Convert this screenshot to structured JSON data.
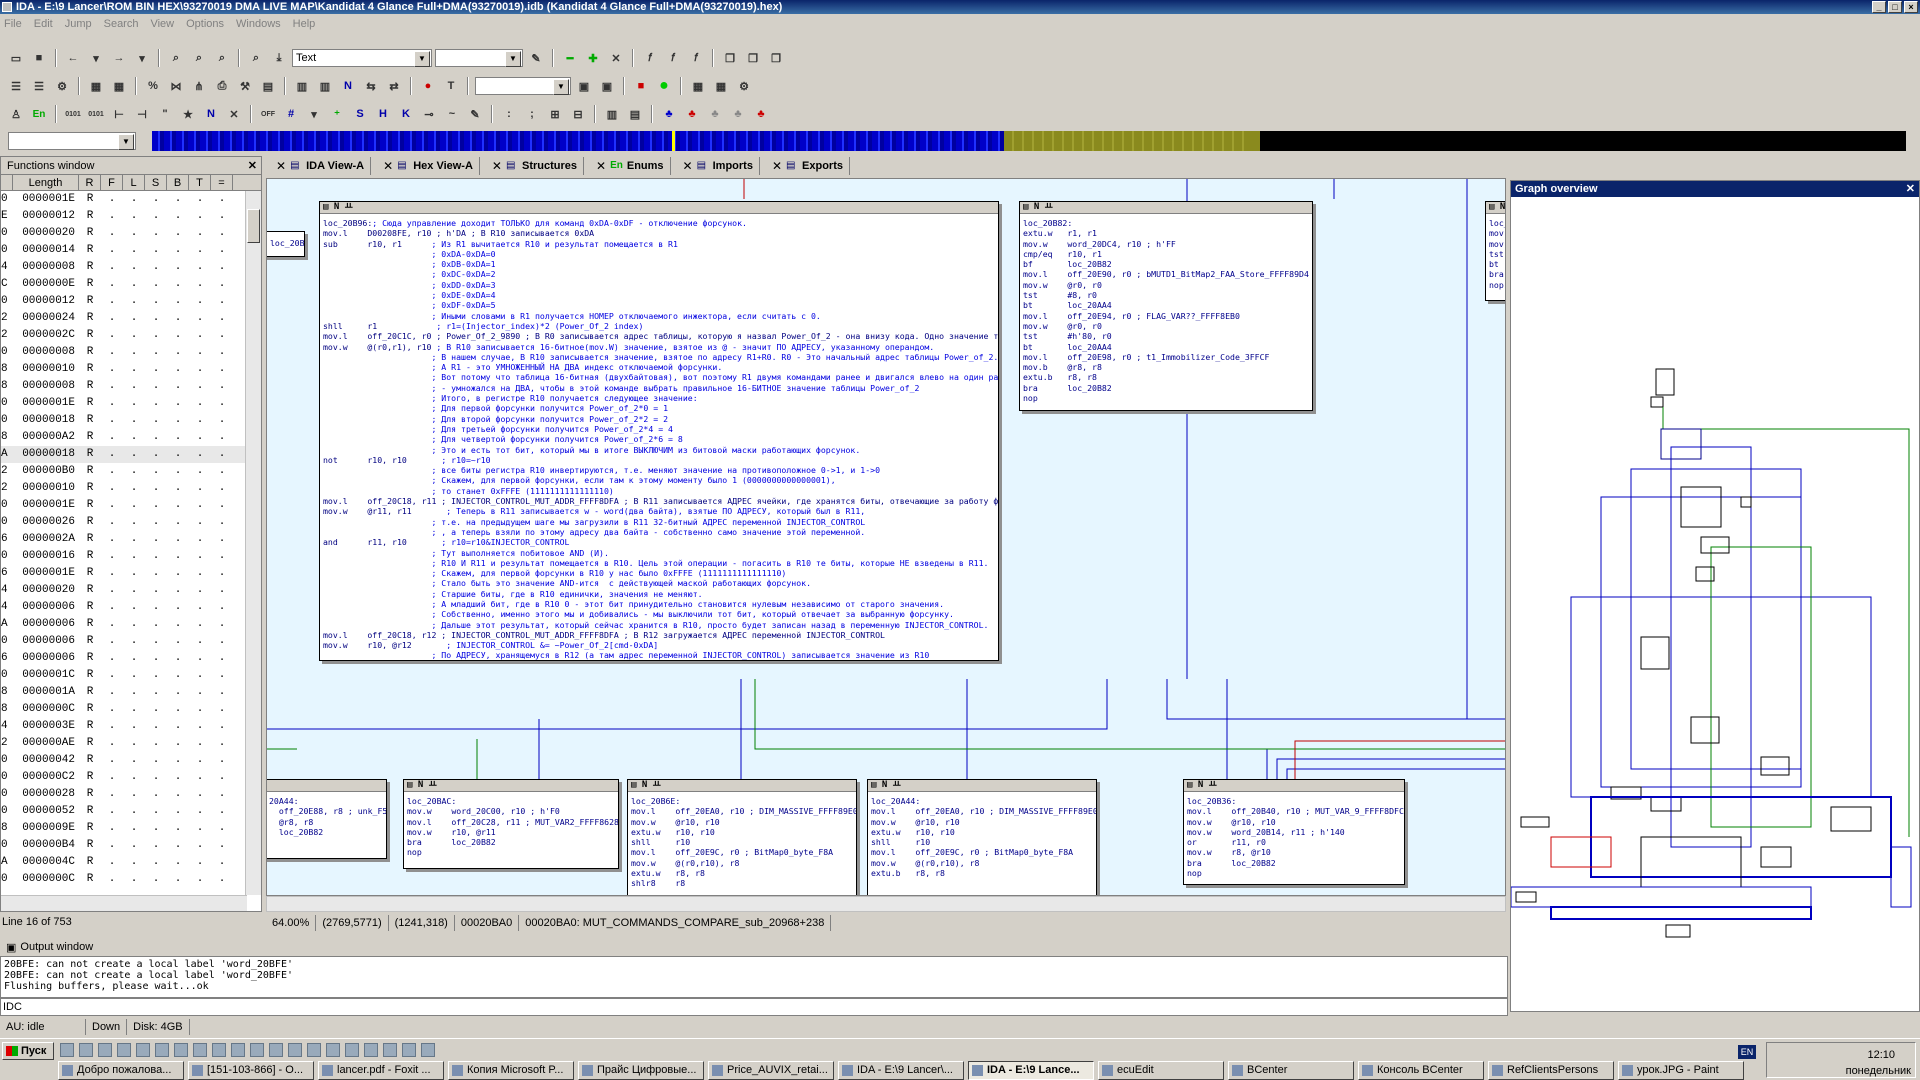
{
  "window": {
    "title": "IDA - E:\\9 Lancer\\ROM BIN HEX\\93270019 DMA LIVE MAP\\Kandidat 4 Glance Full+DMA(93270019).idb (Kandidat 4 Glance Full+DMA(93270019).hex)"
  },
  "menu": [
    "File",
    "Edit",
    "Jump",
    "Search",
    "View",
    "Options",
    "Windows",
    "Help"
  ],
  "toolbar": {
    "mode_combo": "Text",
    "row2_glyph_N": "N",
    "row2_glyph_T": "T",
    "row3_glyph_N": "N",
    "row3_glyph_S": "S",
    "row3_glyph_H": "H",
    "row3_glyph_K": "K"
  },
  "functions_window": {
    "title": "Functions window",
    "columns": [
      "Length",
      "R",
      "F",
      "L",
      "S",
      "B",
      "T",
      "="
    ],
    "rows": [
      {
        "p": "0",
        "len": "0000001E",
        "r": "R"
      },
      {
        "p": "E",
        "len": "00000012",
        "r": "R"
      },
      {
        "p": "0",
        "len": "00000020",
        "r": "R"
      },
      {
        "p": "0",
        "len": "00000014",
        "r": "R"
      },
      {
        "p": "4",
        "len": "00000008",
        "r": "R"
      },
      {
        "p": "C",
        "len": "0000000E",
        "r": "R"
      },
      {
        "p": "0",
        "len": "00000012",
        "r": "R"
      },
      {
        "p": "2",
        "len": "00000024",
        "r": "R"
      },
      {
        "p": "2",
        "len": "0000002C",
        "r": "R"
      },
      {
        "p": "0",
        "len": "00000008",
        "r": "R"
      },
      {
        "p": "8",
        "len": "00000010",
        "r": "R"
      },
      {
        "p": "8",
        "len": "00000008",
        "r": "R"
      },
      {
        "p": "0",
        "len": "0000001E",
        "r": "R"
      },
      {
        "p": "0",
        "len": "00000018",
        "r": "R"
      },
      {
        "p": "8",
        "len": "000000A2",
        "r": "R"
      },
      {
        "p": "A",
        "len": "00000018",
        "r": "R",
        "sel": true
      },
      {
        "p": "2",
        "len": "000000B0",
        "r": "R"
      },
      {
        "p": "2",
        "len": "00000010",
        "r": "R"
      },
      {
        "p": "0",
        "len": "0000001E",
        "r": "R"
      },
      {
        "p": "0",
        "len": "00000026",
        "r": "R"
      },
      {
        "p": "6",
        "len": "0000002A",
        "r": "R"
      },
      {
        "p": "0",
        "len": "00000016",
        "r": "R"
      },
      {
        "p": "6",
        "len": "0000001E",
        "r": "R"
      },
      {
        "p": "4",
        "len": "00000020",
        "r": "R"
      },
      {
        "p": "4",
        "len": "00000006",
        "r": "R"
      },
      {
        "p": "A",
        "len": "00000006",
        "r": "R"
      },
      {
        "p": "0",
        "len": "00000006",
        "r": "R"
      },
      {
        "p": "6",
        "len": "00000006",
        "r": "R"
      },
      {
        "p": "0",
        "len": "0000001C",
        "r": "R"
      },
      {
        "p": "8",
        "len": "0000001A",
        "r": "R"
      },
      {
        "p": "8",
        "len": "0000000C",
        "r": "R"
      },
      {
        "p": "4",
        "len": "0000003E",
        "r": "R"
      },
      {
        "p": "2",
        "len": "000000AE",
        "r": "R"
      },
      {
        "p": "0",
        "len": "00000042",
        "r": "R"
      },
      {
        "p": "0",
        "len": "000000C2",
        "r": "R"
      },
      {
        "p": "0",
        "len": "00000028",
        "r": "R"
      },
      {
        "p": "0",
        "len": "00000052",
        "r": "R"
      },
      {
        "p": "8",
        "len": "0000009E",
        "r": "R"
      },
      {
        "p": "0",
        "len": "000000B4",
        "r": "R"
      },
      {
        "p": "A",
        "len": "0000004C",
        "r": "R"
      },
      {
        "p": "0",
        "len": "0000000C",
        "r": "R"
      }
    ],
    "line_info": "Line 16 of 753"
  },
  "tabs": [
    {
      "label": "IDA View-A"
    },
    {
      "label": "Hex View-A"
    },
    {
      "label": "Structures"
    },
    {
      "label": "Enums",
      "prefix": "En"
    },
    {
      "label": "Imports"
    },
    {
      "label": "Exports"
    }
  ],
  "graph": {
    "main_block": [
      {
        "t": "loc_20B96:",
        "c": "; Сюда управление доходит ТОЛЬКО для команд 0xDA-0xDF - отключение форсунок."
      },
      {
        "t": "mov.l    D00208FE, r10 ; h'DA ; В R10 записывается 0xDA",
        "c": ""
      },
      {
        "t": "sub      r10, r1",
        "c": "      ; Из R1 вычитается R10 и результат помещается в R1"
      },
      {
        "t": "",
        "c": "                      ; 0xDA-0xDA=0"
      },
      {
        "t": "",
        "c": "                      ; 0xDB-0xDA=1"
      },
      {
        "t": "",
        "c": "                      ; 0xDC-0xDA=2"
      },
      {
        "t": "",
        "c": "                      ; 0xDD-0xDA=3"
      },
      {
        "t": "",
        "c": "                      ; 0xDE-0xDA=4"
      },
      {
        "t": "",
        "c": "                      ; 0xDF-0xDA=5"
      },
      {
        "t": "",
        "c": "                      ; Иными словами в R1 получается НОМЕР отключаемого инжектора, если считать с 0."
      },
      {
        "t": "shll     r1",
        "c": "            ; r1=(Injector_index)*2 (Power_Of_2 index)"
      },
      {
        "t": "mov.l    off_20C1C, r0 ; Power_Of_2_9890 ; В R0 записывается адрес таблицы, которую я назвал Power_Of_2 - она внизу кода. Одно значение таблицы занимает ДВА байта.",
        "c": ""
      },
      {
        "t": "mov.w    @(r0,r1), r10",
        "c": " ; В R10 записывается 16-битное(mov.W) значение, взятое из @ - значит ПО АДРЕСУ, указанному операндом."
      },
      {
        "t": "",
        "c": "                      ; В нашем случае, В R10 записывается значение, взятое по адресу R1+R0. R0 - Это начальный адрес таблицы Power_of_2."
      },
      {
        "t": "",
        "c": "                      ; А R1 - это УМНОЖЕННЫЙ НА ДВА индекс отключаемой форсунки."
      },
      {
        "t": "",
        "c": "                      ; Вот потому что таблица 16-битная (двухбайтовая), вот поэтому R1 двумя командами ранее и двигался влево на один разряд"
      },
      {
        "t": "",
        "c": "                      ; - умножался на ДВА, чтобы в этой команде выбрать правильное 16-БИТНОЕ значение таблицы Power_of_2"
      },
      {
        "t": "",
        "c": "                      ; Итого, в регистре R10 получается следующее значение:"
      },
      {
        "t": "",
        "c": "                      ; Для первой форсунки получится Power_of_2*0 = 1"
      },
      {
        "t": "",
        "c": "                      ; Для второй форсунки получится Power_of_2*2 = 2"
      },
      {
        "t": "",
        "c": "                      ; Для третьей форсунки получится Power_of_2*4 = 4"
      },
      {
        "t": "",
        "c": "                      ; Для четвертой форсунки получится Power_of_2*6 = 8"
      },
      {
        "t": "",
        "c": "                      ; Это и есть тот бит, который мы в итоге ВЫКЛЮЧИМ из битовой маски работающих форсунок."
      },
      {
        "t": "not      r10, r10",
        "c": "       ; r10=~r10"
      },
      {
        "t": "",
        "c": "                      ; все биты регистра R10 инвертируются, т.е. меняют значение на противоположное 0->1, и 1->0"
      },
      {
        "t": "",
        "c": "                      ; Скажем, для первой форсунки, если там к этому моменту было 1 (0000000000000001),"
      },
      {
        "t": "",
        "c": "                      ; то станет 0xFFFE (1111111111111110)"
      },
      {
        "t": "mov.l    off_20C18, r11 ; INJECTOR_CONTROL_MUT_ADDR_FFFF8DFA ; В R11 записывается АДРЕС ячейки, где хранятся биты, отвечающие за работу форсунок.",
        "c": ""
      },
      {
        "t": "mov.w    @r11, r11",
        "c": "       ; Теперь в R11 записывается w - word(два байта), взятые ПО АДРЕСУ, который был в R11,"
      },
      {
        "t": "",
        "c": "                      ; т.е. на предыдущем шаге мы загрузили в R11 32-битный АДРЕС переменной INJECTOR_CONTROL"
      },
      {
        "t": "",
        "c": "                      ; , а теперь взяли по этому адресу два байта - собственно само значение этой переменной."
      },
      {
        "t": "and      r11, r10",
        "c": "       ; r10=r10&INJECTOR_CONTROL"
      },
      {
        "t": "",
        "c": "                      ; Тут выполняется побитовое AND (И)."
      },
      {
        "t": "",
        "c": "                      ; R10 И R11 и результат помещается в R10. Цель этой операции - погасить в R10 те биты, которые НЕ взведены в R11."
      },
      {
        "t": "",
        "c": "                      ; Скажем, для первой форсунки в R10 у нас было 0xFFFE (1111111111111110)"
      },
      {
        "t": "",
        "c": "                      ; Стало быть это значение AND-ится  с действующей маской работающих форсунок."
      },
      {
        "t": "",
        "c": "                      ; Старшие биты, где в R10 единички, значения не меняют."
      },
      {
        "t": "",
        "c": "                      ; А младший бит, где в R10 0 - этот бит принудительно становится нулевым независимо от старого значения."
      },
      {
        "t": "",
        "c": "                      ; Собственно, именно этого мы и добивались - мы выключили тот бит, который отвечает за выбранную форсунку."
      },
      {
        "t": "",
        "c": "                      ; Дальше этот результат, который сейчас хранится в R10, просто будет записан назад в переменную INJECTOR_CONTROL."
      },
      {
        "t": "mov.l    off_20C18, r12 ; INJECTOR_CONTROL_MUT_ADDR_FFFF8DFA ; В R12 загружается АДРЕС переменной INJECTOR_CONTROL",
        "c": ""
      },
      {
        "t": "mov.w    r10, @r12",
        "c": "       ; INJECTOR_CONTROL &= ~Power_Of_2[cmd-0xDA]"
      },
      {
        "t": "",
        "c": "                      ; По АДРЕСУ, хранящемуся в R12 (а там адрес переменной INJECTOR_CONTROL) записывается значение из R10"
      }
    ],
    "right_block": [
      "loc_20B82:",
      "extu.w   r1, r1",
      "mov.w    word_20DC4, r10 ; h'FF",
      "cmp/eq   r10, r1",
      "bf       loc_20B82",
      "mov.l    off_20E90, r0 ; bMUTD1_BitMap2_FAA_Store_FFFF89D4",
      "mov.w    @r0, r0",
      "tst      #8, r0",
      "bt       loc_20AA4",
      "mov.l    off_20E94, r0 ; FLAG_VAR??_FFFF8EB0",
      "mov.w    @r0, r0",
      "tst      #h'80, r0",
      "bt       loc_20AA4",
      "mov.l    off_20E98, r0 ; t1_Immobilizer_Code_3FFCF",
      "mov.b    @r8, r8",
      "extu.b   r8, r8",
      "bra      loc_20B82",
      "nop"
    ],
    "edge_block": [
      "loc_",
      "mov.",
      "mov.",
      "tst",
      "bt",
      "bra",
      "nop"
    ],
    "left_top_block": [
      "loc_20B0"
    ],
    "bottom_blocks": [
      {
        "lines": [
          "20A44:",
          "  off_20E88, r8 ; unk_F58",
          "  @r8, r8",
          "  loc_20B82"
        ]
      },
      {
        "lines": [
          "loc_20BAC:",
          "mov.w    word_20C00, r10 ; h'F0",
          "mov.l    off_20C28, r11 ; MUT_VAR2_FFFF8628",
          "mov.w    r10, @r11",
          "bra      loc_20B82",
          "nop"
        ]
      },
      {
        "lines": [
          "loc_20B6E:",
          "mov.l    off_20EA0, r10 ; DIM_MASSIVE_FFFF89E0",
          "mov.w    @r10, r10",
          "extu.w   r10, r10",
          "shll     r10",
          "mov.l    off_20E9C, r0 ; BitMap0_byte_F8A",
          "mov.w    @(r0,r10), r8",
          "extu.w   r8, r8",
          "shlr8    r8"
        ]
      },
      {
        "lines": [
          "loc_20A44:",
          "mov.l    off_20EA0, r10 ; DIM_MASSIVE_FFFF89E0",
          "mov.w    @r10, r10",
          "extu.w   r10, r10",
          "shll     r10",
          "mov.l    off_20E9C, r0 ; BitMap0_byte_F8A",
          "mov.w    @(r0,r10), r8",
          "extu.b   r8, r8"
        ]
      },
      {
        "lines": [
          "loc_20B36:",
          "mov.l    off_20B40, r10 ; MUT_VAR_9_FFFF8DFC",
          "mov.w    @r10, r10",
          "mov.w    word_20B14, r11 ; h'140",
          "or       r11, r0",
          "mov.w    r8, @r10",
          "bra      loc_20B82",
          "nop"
        ]
      }
    ]
  },
  "graph_status": {
    "zoom": "64.00%",
    "coords1": "(2769,5771)",
    "coords2": "(1241,318)",
    "address": "00020BA0",
    "location": "00020BA0: MUT_COMMANDS_COMPARE_sub_20968+238"
  },
  "overview": {
    "title": "Graph overview"
  },
  "output": {
    "title": "Output window",
    "lines": [
      "20BFE: can not create a local label 'word_20BFE'",
      "20BFE: can not create a local label 'word_20BFE'",
      "Flushing buffers, please wait...ok"
    ],
    "idc_label": "IDC"
  },
  "status": {
    "au": "AU:  idle",
    "dir": "Down",
    "disk": "Disk: 4GB"
  },
  "taskbar": {
    "start": "Пуск",
    "tasks": [
      {
        "label": "Добро пожалова..."
      },
      {
        "label": "[151-103-866] - O..."
      },
      {
        "label": "lancer.pdf - Foxit ..."
      },
      {
        "label": "Копия Microsoft P..."
      },
      {
        "label": "Прайс Цифровые..."
      },
      {
        "label": "Price_AUVIX_retai..."
      },
      {
        "label": "IDA - E:\\9 Lancer\\..."
      },
      {
        "label": "IDA - E:\\9 Lance...",
        "active": true
      },
      {
        "label": "ecuEdit"
      },
      {
        "label": "BCenter"
      },
      {
        "label": "Консоль BCenter"
      },
      {
        "label": "RefClientsPersons"
      },
      {
        "label": "урок.JPG - Paint"
      }
    ],
    "lang": "EN",
    "time": "12:10",
    "day": "понедельник"
  }
}
